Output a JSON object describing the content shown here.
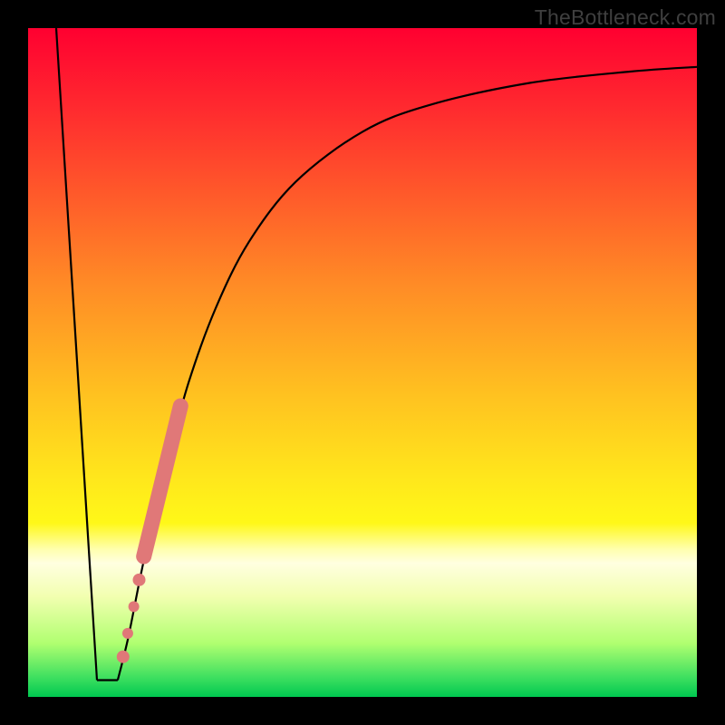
{
  "watermark": "TheBottleneck.com",
  "chart_data": {
    "type": "line",
    "title": "",
    "xlabel": "",
    "ylabel": "",
    "xlim": [
      0,
      100
    ],
    "ylim": [
      0,
      100
    ],
    "grid": false,
    "legend": false,
    "series": [
      {
        "name": "left-slope",
        "x": [
          4.2,
          10.3
        ],
        "y": [
          100,
          2.5
        ]
      },
      {
        "name": "valley-floor",
        "x": [
          10.3,
          13.4
        ],
        "y": [
          2.5,
          2.5
        ]
      },
      {
        "name": "recovery-curve",
        "x": [
          13.4,
          15,
          17,
          19,
          21,
          24,
          28,
          33,
          40,
          50,
          60,
          75,
          90,
          100
        ],
        "y": [
          2.5,
          9,
          19,
          28,
          36,
          47,
          58,
          68,
          77,
          84.5,
          88.5,
          91.8,
          93.5,
          94.2
        ]
      }
    ],
    "highlight": {
      "name": "highlight-segment",
      "color": "#e07878",
      "points": [
        {
          "x": 14.2,
          "y": 6.0,
          "r": 7
        },
        {
          "x": 14.9,
          "y": 9.5,
          "r": 6
        },
        {
          "x": 15.8,
          "y": 13.5,
          "r": 6
        },
        {
          "x": 16.6,
          "y": 17.5,
          "r": 7
        }
      ],
      "bar": {
        "x0": 17.3,
        "y0": 21.0,
        "x1": 22.8,
        "y1": 43.5,
        "width": 17
      }
    }
  }
}
